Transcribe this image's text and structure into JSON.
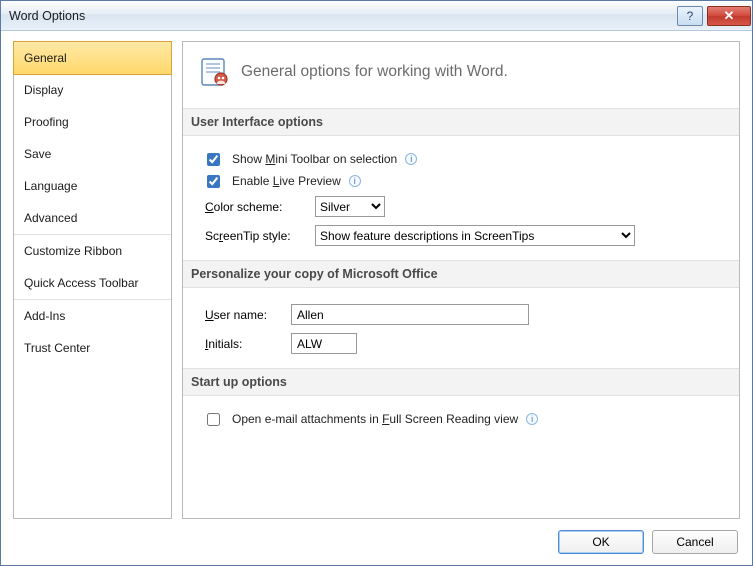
{
  "title": "Word Options",
  "sidebar": {
    "items": [
      {
        "label": "General",
        "selected": true
      },
      {
        "label": "Display"
      },
      {
        "label": "Proofing"
      },
      {
        "label": "Save"
      },
      {
        "label": "Language"
      },
      {
        "label": "Advanced"
      },
      {
        "label": "Customize Ribbon"
      },
      {
        "label": "Quick Access Toolbar"
      },
      {
        "label": "Add-Ins"
      },
      {
        "label": "Trust Center"
      }
    ]
  },
  "main": {
    "header": "General options for working with Word.",
    "ui_section": {
      "title": "User Interface options",
      "mini_toolbar": {
        "checked": true,
        "pre": "Show ",
        "u": "M",
        "post": "ini Toolbar on selection"
      },
      "live_preview": {
        "checked": true,
        "pre": "Enable ",
        "u": "L",
        "post": "ive Preview"
      },
      "color_scheme": {
        "label_pre": "",
        "label_u": "C",
        "label_post": "olor scheme:",
        "value": "Silver"
      },
      "screentip": {
        "label_pre": "Sc",
        "label_u": "r",
        "label_post": "eenTip style:",
        "value": "Show feature descriptions in ScreenTips"
      }
    },
    "personalize_section": {
      "title": "Personalize your copy of Microsoft Office",
      "username": {
        "label_u": "U",
        "label_post": "ser name:",
        "value": "Allen"
      },
      "initials": {
        "label_u": "I",
        "label_post": "nitials:",
        "value": "ALW"
      }
    },
    "startup_section": {
      "title": "Start up options",
      "fullscreen": {
        "checked": false,
        "pre": "Open e-mail attachments in ",
        "u": "F",
        "post": "ull Screen Reading view"
      }
    }
  },
  "footer": {
    "ok": "OK",
    "cancel": "Cancel"
  }
}
